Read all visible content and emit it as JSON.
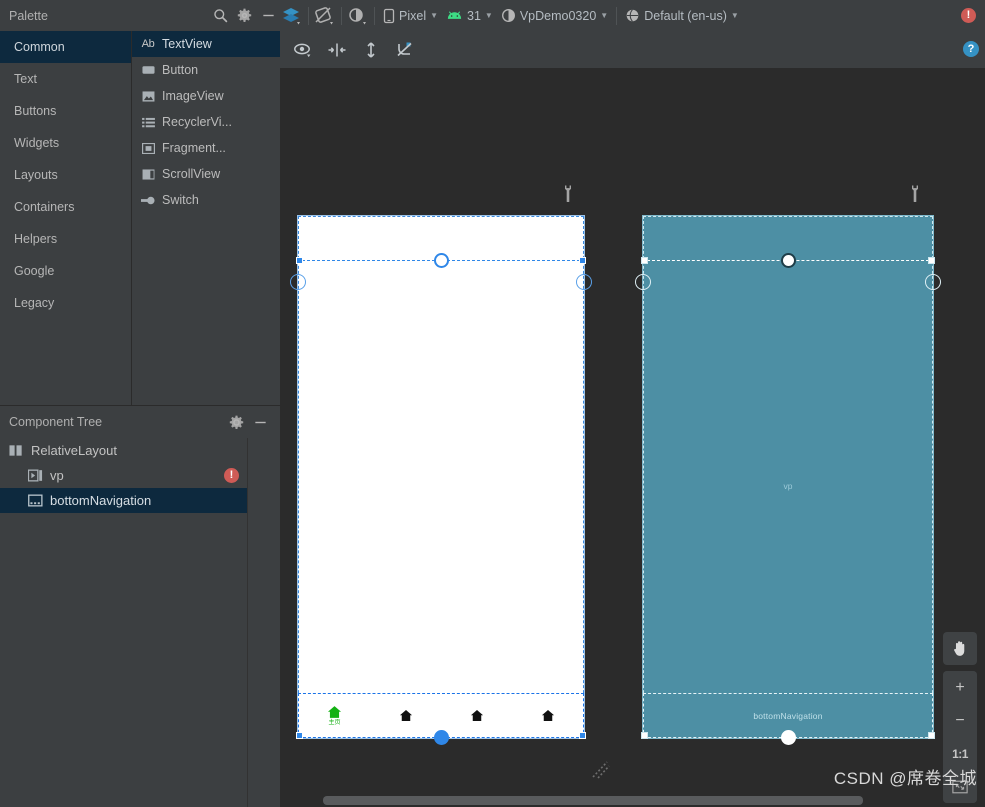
{
  "toolbar": {
    "palette_title": "Palette",
    "search_icon": "search-icon",
    "gear_icon": "gear-icon",
    "minimize_icon": "minimize-icon",
    "layers_label": "design-surface-mode",
    "orientation_label": "orientation-rotate",
    "theme_label": "theme-selector",
    "device": "Pixel",
    "api_level": "31",
    "theme": "VpDemo0320",
    "locale": "Default (en-us)",
    "error_badge": "!"
  },
  "palette": {
    "categories": [
      {
        "label": "Common",
        "selected": true
      },
      {
        "label": "Text",
        "selected": false
      },
      {
        "label": "Buttons",
        "selected": false
      },
      {
        "label": "Widgets",
        "selected": false
      },
      {
        "label": "Layouts",
        "selected": false
      },
      {
        "label": "Containers",
        "selected": false
      },
      {
        "label": "Helpers",
        "selected": false
      },
      {
        "label": "Google",
        "selected": false
      },
      {
        "label": "Legacy",
        "selected": false
      }
    ],
    "items": [
      {
        "label": "TextView",
        "icon": "textview-icon",
        "selected": true
      },
      {
        "label": "Button",
        "icon": "button-icon",
        "selected": false
      },
      {
        "label": "ImageView",
        "icon": "imageview-icon",
        "selected": false
      },
      {
        "label": "RecyclerVi...",
        "icon": "recyclerview-icon",
        "selected": false
      },
      {
        "label": "Fragment...",
        "icon": "fragment-icon",
        "selected": false
      },
      {
        "label": "ScrollView",
        "icon": "scrollview-icon",
        "selected": false
      },
      {
        "label": "Switch",
        "icon": "switch-icon",
        "selected": false
      }
    ]
  },
  "component_tree": {
    "title": "Component Tree",
    "gear_icon": "gear-icon",
    "minimize_icon": "minimize-icon",
    "nodes": [
      {
        "label": "RelativeLayout",
        "icon": "relativelayout-icon",
        "depth": 0,
        "selected": false,
        "error": false
      },
      {
        "label": "vp",
        "icon": "viewpager-icon",
        "depth": 1,
        "selected": false,
        "error": true
      },
      {
        "label": "bottomNavigation",
        "icon": "bottomnavigation-icon",
        "depth": 1,
        "selected": true,
        "error": false
      }
    ]
  },
  "editor_toolbar": {
    "buttons": [
      {
        "name": "view-options-icon",
        "title": "View Options"
      },
      {
        "name": "align-horizontal-icon",
        "title": "Align Horizontally"
      },
      {
        "name": "align-vertical-icon",
        "title": "Align Vertically"
      },
      {
        "name": "clear-constraints-icon",
        "title": "Clear All Constraints"
      }
    ],
    "help_label": "?"
  },
  "canvas": {
    "design_wrench": "device-config-wrench-icon",
    "blueprint_wrench": "device-config-wrench-icon",
    "blueprint_vp_label": "vp",
    "blueprint_bottomnav_label": "bottomNavigation",
    "bottom_nav_items": [
      {
        "label": "主页",
        "icon": "home-icon",
        "selected": true
      },
      {
        "label": "",
        "icon": "home-icon",
        "selected": false
      },
      {
        "label": "",
        "icon": "home-icon",
        "selected": false
      },
      {
        "label": "",
        "icon": "home-icon",
        "selected": false
      }
    ],
    "selected_color": "#13b113",
    "unselected_color": "#111111",
    "blueprint_fill": "#4d8fa4",
    "selection_color": "#2f87e8"
  },
  "zoom_controls": {
    "pan_label": "pan-tool",
    "zoom_in_label": "+",
    "zoom_out_label": "−",
    "actual_size_label": "1:1",
    "fit_label": "zoom-to-fit"
  },
  "watermark": "CSDN @席卷全城"
}
